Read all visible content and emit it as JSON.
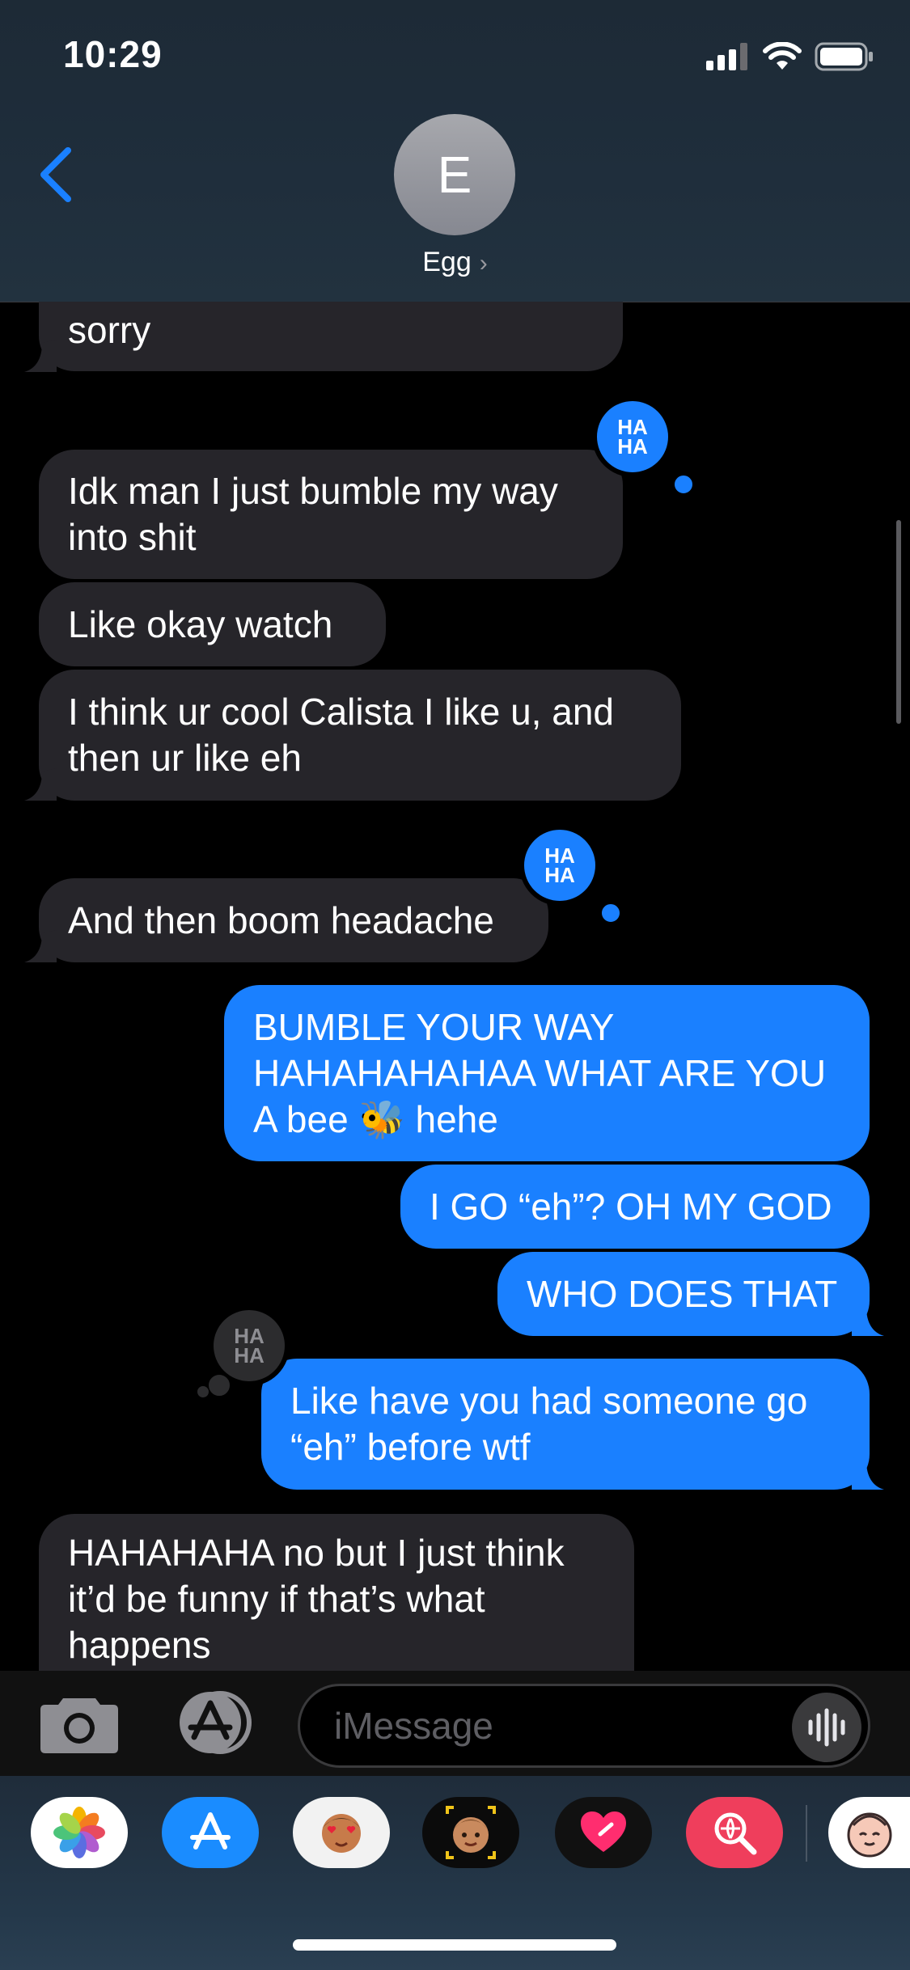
{
  "status_bar": {
    "time": "10:29"
  },
  "contact": {
    "initial": "E",
    "name": "Egg",
    "chevron": "›"
  },
  "messages": [
    {
      "dir": "received",
      "text": "sorry"
    },
    {
      "dir": "received",
      "text": "Idk man I just bumble my way\ninto shit",
      "tapback": "HAHA"
    },
    {
      "dir": "received",
      "text": "Like okay watch"
    },
    {
      "dir": "received",
      "text": "I think ur cool Calista I like u, and\nthen ur like eh"
    },
    {
      "dir": "received",
      "text": "And then boom headache",
      "tapback": "HAHA"
    },
    {
      "dir": "sent",
      "text_before": "BUMBLE YOUR WAY\nHAHAHAHAHAA WHAT ARE YOU\nA bee ",
      "emoji": "🐝",
      "text_after": " hehe"
    },
    {
      "dir": "sent",
      "text": "I GO “eh”? OH MY GOD"
    },
    {
      "dir": "sent",
      "text": "WHO DOES THAT"
    },
    {
      "dir": "sent",
      "text": "Like have you had someone go\n“eh” before wtf",
      "tapback": "HAHA"
    },
    {
      "dir": "received",
      "text": "HAHAHAHA no but I just think\nit’d be funny if that’s what\nhappens"
    }
  ],
  "tapback_label": {
    "line1": "HA",
    "line2": "HA"
  },
  "input": {
    "placeholder": "iMessage"
  },
  "app_drawer": [
    {
      "name": "photos-app-icon",
      "color": "#ffffff"
    },
    {
      "name": "app-store-icon",
      "color": "#1a8cff"
    },
    {
      "name": "memoji-stickers-icon",
      "color": "#f2f2f2"
    },
    {
      "name": "memoji-icon",
      "color": "#0b0b0b"
    },
    {
      "name": "digital-touch-icon",
      "color": "#111111"
    },
    {
      "name": "images-search-icon",
      "color": "#ef3e5c"
    },
    {
      "name": "sticker-app-icon",
      "color": "#ffffff"
    }
  ],
  "colors": {
    "sent": "#1a80ff",
    "received": "#26252a",
    "accent": "#1a80ff"
  }
}
